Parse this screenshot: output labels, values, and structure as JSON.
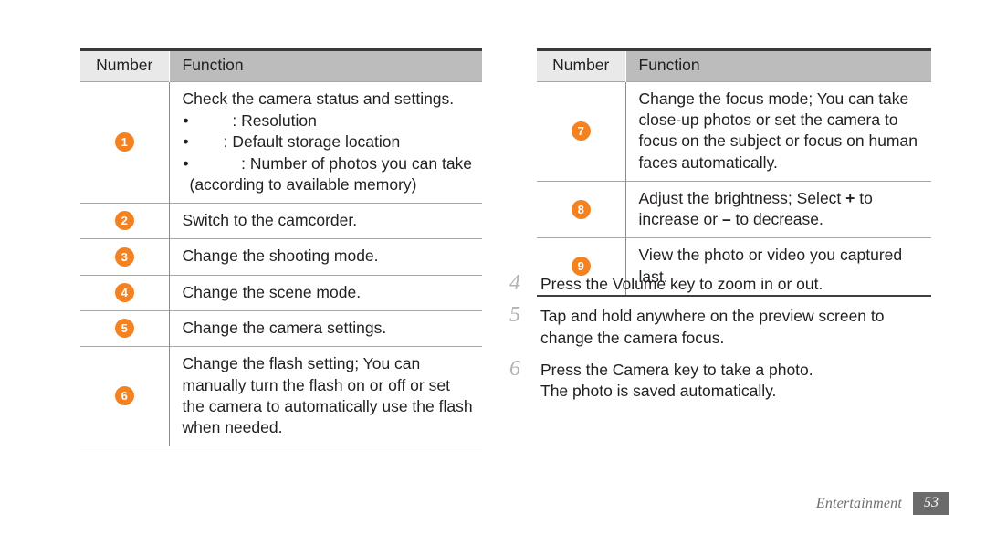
{
  "page": {
    "footer_label": "Entertainment",
    "page_number": "53",
    "accent_color": "#f58220",
    "header_num_bg": "#e9e9e9",
    "header_fun_bg": "#bcbcbc",
    "rule_color": "#3a3a3a",
    "text_color": "#231f20"
  },
  "left_table": {
    "headers": {
      "number": "Number",
      "function": "Function"
    },
    "rows": [
      {
        "number": "1",
        "lead": "Check the camera status and settings.",
        "bullets": [
          "        : Resolution",
          "      : Default storage location",
          "          : Number of photos you can take"
        ],
        "continuation": "(according to available memory)"
      },
      {
        "number": "2",
        "lead": "Switch to the camcorder."
      },
      {
        "number": "3",
        "lead": "Change the shooting mode."
      },
      {
        "number": "4",
        "lead": "Change the scene mode."
      },
      {
        "number": "5",
        "lead": "Change the camera settings."
      },
      {
        "number": "6",
        "lead": "Change the flash setting; You can manually turn the flash on or off or set the camera to automatically use the flash when needed."
      }
    ]
  },
  "right_table": {
    "headers": {
      "number": "Number",
      "function": "Function"
    },
    "rows": [
      {
        "number": "7",
        "lead": "Change the focus mode; You can take close-up photos or set the camera to focus on the subject or focus on human faces automatically."
      },
      {
        "number": "8",
        "lead_before_plus": "Adjust the brightness; Select ",
        "plus_symbol": "+",
        "lead_mid": " to increase or ",
        "minus_symbol": "–",
        "lead_after": " to decrease."
      },
      {
        "number": "9",
        "lead": "View the photo or video you captured last."
      }
    ]
  },
  "steps": [
    {
      "num": "4",
      "text": "Press the Volume key to zoom in or out.",
      "sub": ""
    },
    {
      "num": "5",
      "text": "Tap and hold anywhere on the preview screen to change the camera focus.",
      "sub": ""
    },
    {
      "num": "6",
      "text": "Press the Camera key to take a photo.",
      "sub": "The photo is saved automatically."
    }
  ]
}
